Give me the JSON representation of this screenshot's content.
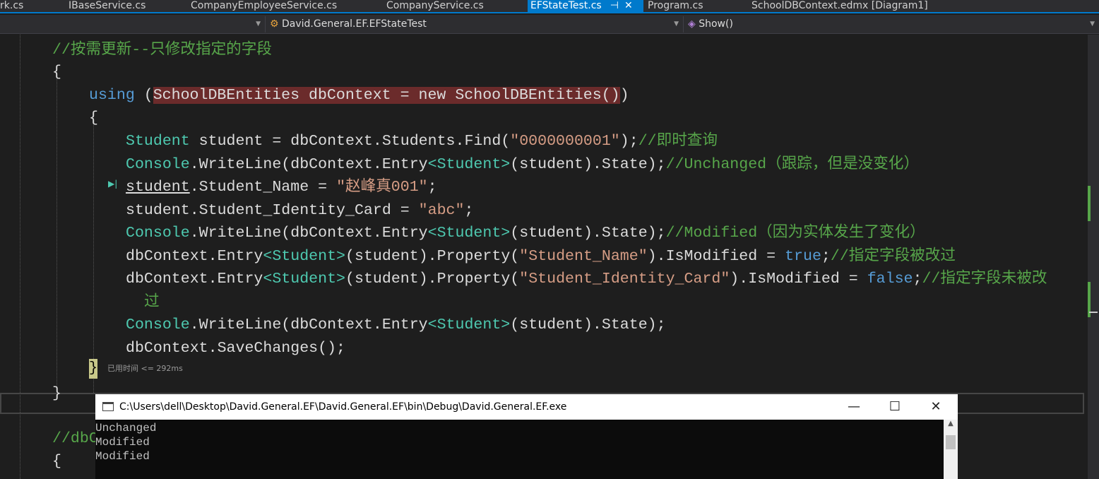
{
  "tabs": [
    "rk.cs",
    "IBaseService.cs",
    "CompanyEmployeeService.cs",
    "CompanyService.cs",
    "EFStateTest.cs",
    "Program.cs",
    "SchoolDBContext.edmx [Diagram1]"
  ],
  "active_tab": "EFStateTest.cs",
  "nav": {
    "class_combo": "David.General.EF.EFStateTest",
    "member_combo": "Show()"
  },
  "code_lines": [
    [
      [
        "//按需更新--只修改指定的字段",
        "cm"
      ]
    ],
    [
      [
        "{",
        ""
      ]
    ],
    [
      [
        "using",
        "kw"
      ],
      [
        " (",
        ""
      ],
      [
        "SchoolDBEntities dbContext = new SchoolDBEntities()",
        "hl"
      ],
      [
        ")",
        ""
      ]
    ],
    [
      [
        "{",
        ""
      ]
    ],
    [
      [
        "Student",
        "ty"
      ],
      [
        " student = dbContext.Students.Find(",
        ""
      ],
      [
        "\"0000000001\"",
        "st"
      ],
      [
        ");",
        ""
      ],
      [
        "//即时查询",
        "cm"
      ]
    ],
    [
      [
        "Console",
        "ty"
      ],
      [
        ".WriteLine(dbContext.Entry",
        ""
      ],
      [
        "<Student>",
        "ty"
      ],
      [
        "(student).State);",
        ""
      ],
      [
        "//Unchanged（跟踪，但是没变化）",
        "cm"
      ]
    ],
    [
      [
        "student",
        "ul"
      ],
      [
        ".Student_Name = ",
        ""
      ],
      [
        "\"赵峰真001\"",
        "st"
      ],
      [
        ";",
        ""
      ]
    ],
    [
      [
        "student.Student_Identity_Card = ",
        ""
      ],
      [
        "\"abc\"",
        "st"
      ],
      [
        ";",
        ""
      ]
    ],
    [
      [
        "Console",
        "ty"
      ],
      [
        ".WriteLine(dbContext.Entry",
        ""
      ],
      [
        "<Student>",
        "ty"
      ],
      [
        "(student).State);",
        ""
      ],
      [
        "//Modified（因为实体发生了变化）",
        "cm"
      ]
    ],
    [
      [
        "dbContext.Entry",
        ""
      ],
      [
        "<Student>",
        "ty"
      ],
      [
        "(student).Property(",
        ""
      ],
      [
        "\"Student_Name\"",
        "st"
      ],
      [
        ").IsModified = ",
        ""
      ],
      [
        "true",
        "kw"
      ],
      [
        ";",
        ""
      ],
      [
        "//指定字段被改过",
        "cm"
      ]
    ],
    [
      [
        "dbContext.Entry",
        ""
      ],
      [
        "<Student>",
        "ty"
      ],
      [
        "(student).Property(",
        ""
      ],
      [
        "\"Student_Identity_Card\"",
        "st"
      ],
      [
        ").IsModified = ",
        ""
      ],
      [
        "false",
        "kw"
      ],
      [
        ";",
        ""
      ],
      [
        "//指定字段未被改",
        "cm"
      ]
    ],
    [
      [
        "过",
        "cm"
      ]
    ],
    [
      [
        "Console",
        "ty"
      ],
      [
        ".WriteLine(dbContext.Entry",
        ""
      ],
      [
        "<Student>",
        "ty"
      ],
      [
        "(student).State);",
        ""
      ]
    ],
    [
      [
        "dbContext.SaveChanges();",
        ""
      ]
    ],
    [
      [
        "}",
        ""
      ]
    ],
    [
      [
        "}",
        ""
      ]
    ],
    [
      [
        "//dbC",
        "cm"
      ]
    ],
    [
      [
        "{",
        ""
      ]
    ]
  ],
  "perf_tip": "已用时间 <= 292ms",
  "console": {
    "title": "C:\\Users\\dell\\Desktop\\David.General.EF\\David.General.EF\\bin\\Debug\\David.General.EF.exe",
    "output": [
      "Unchanged",
      "Modified",
      "Modified"
    ]
  }
}
